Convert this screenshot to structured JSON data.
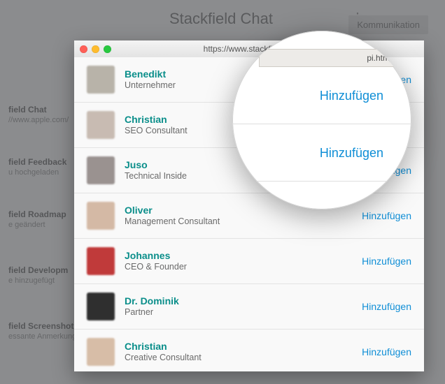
{
  "header": {
    "title": "Stackfield Chat",
    "nav_button": "Kommunikation"
  },
  "window": {
    "url": "https://www.stackfield.co"
  },
  "sidebar": {
    "items": [
      {
        "title": "field Chat",
        "sub": "//www.apple.com/"
      },
      {
        "title": "field Feedback",
        "sub": "u hochgeladen"
      },
      {
        "title": "field Roadmap",
        "sub": "e geändert"
      },
      {
        "title": "field Developm",
        "sub": "e hinzugefügt"
      },
      {
        "title": "field Screenshot",
        "sub": "essante Anmerkung"
      }
    ]
  },
  "contacts": [
    {
      "name": "Benedikt",
      "role": "Unternehmer",
      "action": "Hinzufügen",
      "avatar": "#b8b3a9"
    },
    {
      "name": "Christian",
      "role": "SEO Consultant",
      "action": "Hinzufügen",
      "avatar": "#c8bbb2"
    },
    {
      "name": "Juso",
      "role": "Technical Inside",
      "action": "Hinzufügen",
      "avatar": "#9a9290"
    },
    {
      "name": "Oliver",
      "role": "Management Consultant",
      "action": "Hinzufügen",
      "avatar": "#d4b9a5"
    },
    {
      "name": "Johannes",
      "role": "CEO & Founder",
      "action": "Hinzufügen",
      "avatar": "#c03a3a"
    },
    {
      "name": "Dr. Dominik",
      "role": "Partner",
      "action": "Hinzufügen",
      "avatar": "#2f2f2f"
    },
    {
      "name": "Christian",
      "role": "Creative Consultant",
      "action": "Hinzufügen",
      "avatar": "#d7bda7"
    }
  ],
  "magnifier": {
    "tab_label": "pi.htm",
    "items": [
      {
        "label": "Hinzufügen"
      },
      {
        "label": "Hinzufügen"
      }
    ]
  }
}
